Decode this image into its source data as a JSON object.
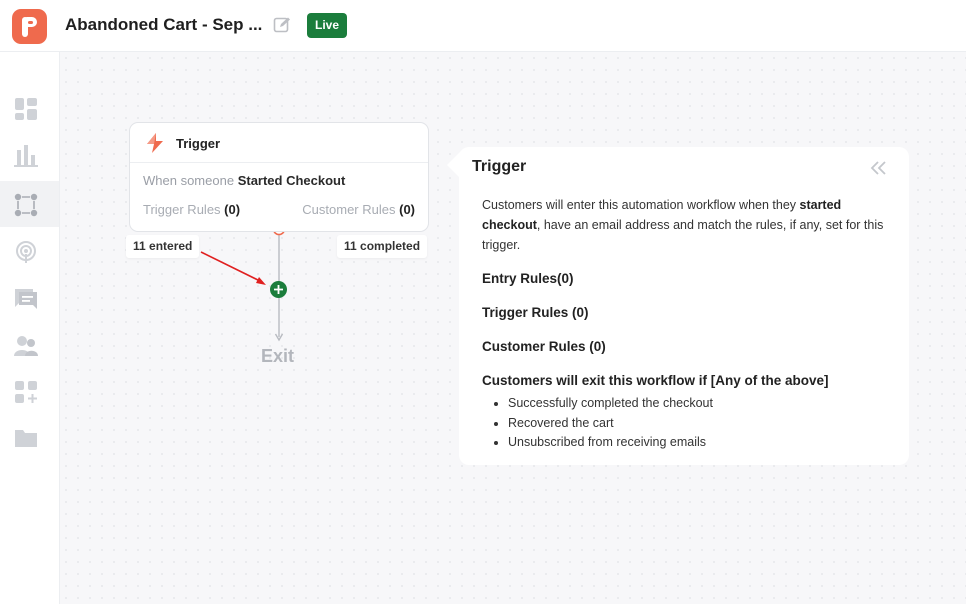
{
  "header": {
    "title": "Abandoned Cart - Sep ...",
    "status_badge": "Live"
  },
  "sidebar": {
    "items": [
      {
        "icon": "dashboard-icon"
      },
      {
        "icon": "analytics-icon"
      },
      {
        "icon": "workflows-icon",
        "active": true
      },
      {
        "icon": "broadcast-icon"
      },
      {
        "icon": "messages-icon"
      },
      {
        "icon": "audience-icon"
      },
      {
        "icon": "integrations-icon"
      },
      {
        "icon": "folder-icon"
      }
    ]
  },
  "trigger_node": {
    "title": "Trigger",
    "when_prefix": "When someone",
    "event": "Started Checkout",
    "trigger_rules_label": "Trigger Rules",
    "trigger_rules_count": "(0)",
    "customer_rules_label": "Customer Rules",
    "customer_rules_count": "(0)",
    "entered": "11 entered",
    "completed": "11 completed"
  },
  "exit_node": {
    "label": "Exit"
  },
  "panel": {
    "title": "Trigger",
    "desc_part1": "Customers will enter this automation workflow when they ",
    "desc_bold": "started checkout",
    "desc_part2": ", have an email address and match the rules, if any, set for this trigger.",
    "entry_rules": "Entry Rules(0)",
    "trigger_rules": "Trigger Rules  (0)",
    "customer_rules": "Customer Rules  (0)",
    "exit_heading": "Customers will exit this workflow if [Any of the above]",
    "exit_conditions": [
      "Successfully completed the checkout",
      "Recovered the cart",
      "Unsubscribed from receiving emails"
    ]
  },
  "colors": {
    "brand": "#ef6a4d",
    "live": "#1b7d3c",
    "annotation_arrow": "#e02020"
  }
}
